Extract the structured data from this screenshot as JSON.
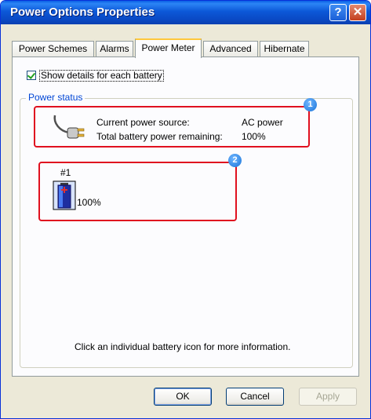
{
  "window": {
    "title": "Power Options Properties",
    "help_glyph": "?",
    "close_glyph": "✕"
  },
  "tabs": [
    {
      "label": "Power Schemes",
      "active": false
    },
    {
      "label": "Alarms",
      "active": false
    },
    {
      "label": "Power Meter",
      "active": true
    },
    {
      "label": "Advanced",
      "active": false
    },
    {
      "label": "Hibernate",
      "active": false
    }
  ],
  "options": {
    "show_details_label": "Show details for each battery",
    "show_details_checked": true
  },
  "power_status": {
    "group_title": "Power status",
    "source_label": "Current power source:",
    "source_value": "AC power",
    "remaining_label": "Total battery power remaining:",
    "remaining_value": "100%"
  },
  "battery": {
    "number": "#1",
    "percent": "100%",
    "level": 1.0
  },
  "hint": "Click an individual battery icon for more information.",
  "annotations": {
    "badge1": "1",
    "badge2": "2",
    "highlight_color": "#e0101f"
  },
  "buttons": {
    "ok": "OK",
    "cancel": "Cancel",
    "apply": "Apply"
  }
}
